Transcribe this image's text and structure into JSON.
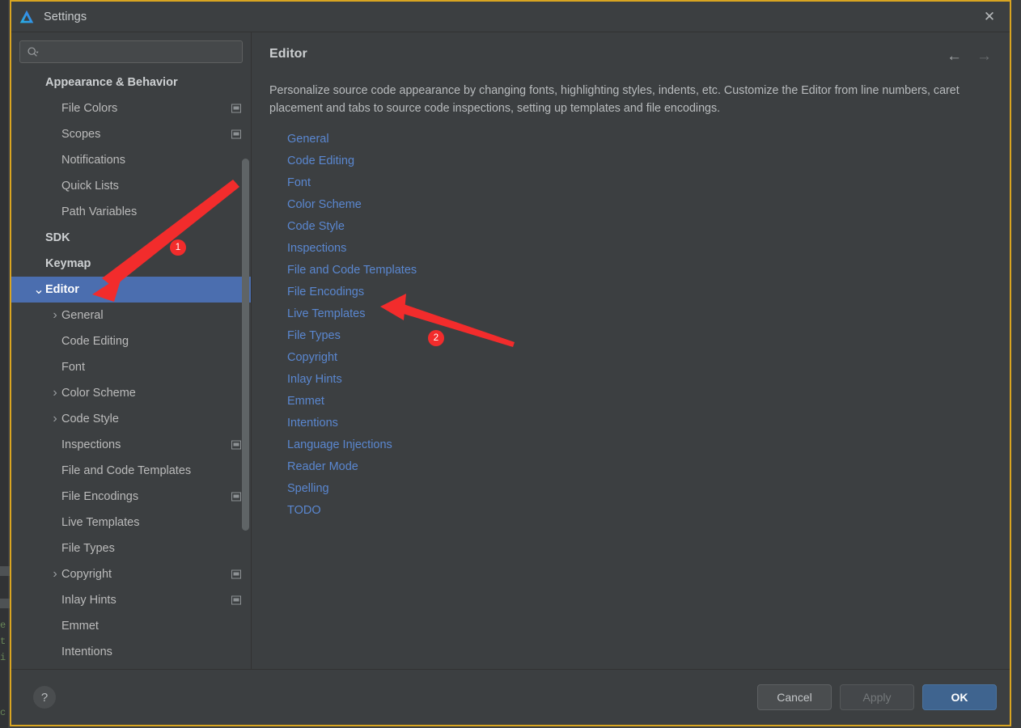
{
  "window": {
    "title": "Settings",
    "logo_icon": "android-studio-logo-icon",
    "close_icon": "✕"
  },
  "search": {
    "placeholder": "",
    "value": "",
    "icon": "search-icon"
  },
  "sidebar": {
    "items": [
      {
        "label": "Appearance & Behavior",
        "level": 0,
        "group": true,
        "twisty": "",
        "badge": false,
        "selected": false
      },
      {
        "label": "File Colors",
        "level": 1,
        "group": false,
        "twisty": "",
        "badge": true,
        "selected": false
      },
      {
        "label": "Scopes",
        "level": 1,
        "group": false,
        "twisty": "",
        "badge": true,
        "selected": false
      },
      {
        "label": "Notifications",
        "level": 1,
        "group": false,
        "twisty": "",
        "badge": false,
        "selected": false
      },
      {
        "label": "Quick Lists",
        "level": 1,
        "group": false,
        "twisty": "",
        "badge": false,
        "selected": false
      },
      {
        "label": "Path Variables",
        "level": 1,
        "group": false,
        "twisty": "",
        "badge": false,
        "selected": false
      },
      {
        "label": "SDK",
        "level": 0,
        "group": true,
        "twisty": "",
        "badge": false,
        "selected": false
      },
      {
        "label": "Keymap",
        "level": 0,
        "group": true,
        "twisty": "",
        "badge": false,
        "selected": false
      },
      {
        "label": "Editor",
        "level": 0,
        "group": true,
        "twisty": "⌄",
        "badge": false,
        "selected": true
      },
      {
        "label": "General",
        "level": 1,
        "group": false,
        "twisty": "›",
        "badge": false,
        "selected": false
      },
      {
        "label": "Code Editing",
        "level": 1,
        "group": false,
        "twisty": "",
        "badge": false,
        "selected": false
      },
      {
        "label": "Font",
        "level": 1,
        "group": false,
        "twisty": "",
        "badge": false,
        "selected": false
      },
      {
        "label": "Color Scheme",
        "level": 1,
        "group": false,
        "twisty": "›",
        "badge": false,
        "selected": false
      },
      {
        "label": "Code Style",
        "level": 1,
        "group": false,
        "twisty": "›",
        "badge": false,
        "selected": false
      },
      {
        "label": "Inspections",
        "level": 1,
        "group": false,
        "twisty": "",
        "badge": true,
        "selected": false
      },
      {
        "label": "File and Code Templates",
        "level": 1,
        "group": false,
        "twisty": "",
        "badge": false,
        "selected": false
      },
      {
        "label": "File Encodings",
        "level": 1,
        "group": false,
        "twisty": "",
        "badge": true,
        "selected": false
      },
      {
        "label": "Live Templates",
        "level": 1,
        "group": false,
        "twisty": "",
        "badge": false,
        "selected": false
      },
      {
        "label": "File Types",
        "level": 1,
        "group": false,
        "twisty": "",
        "badge": false,
        "selected": false
      },
      {
        "label": "Copyright",
        "level": 1,
        "group": false,
        "twisty": "›",
        "badge": true,
        "selected": false
      },
      {
        "label": "Inlay Hints",
        "level": 1,
        "group": false,
        "twisty": "",
        "badge": true,
        "selected": false
      },
      {
        "label": "Emmet",
        "level": 1,
        "group": false,
        "twisty": "",
        "badge": false,
        "selected": false
      },
      {
        "label": "Intentions",
        "level": 1,
        "group": false,
        "twisty": "",
        "badge": false,
        "selected": false
      }
    ]
  },
  "content": {
    "title": "Editor",
    "description": "Personalize source code appearance by changing fonts, highlighting styles, indents, etc. Customize the Editor from line numbers, caret placement and tabs to source code inspections, setting up templates and file encodings.",
    "back_icon": "←",
    "forward_icon": "→",
    "links": [
      "General",
      "Code Editing",
      "Font",
      "Color Scheme",
      "Code Style",
      "Inspections",
      "File and Code Templates",
      "File Encodings",
      "Live Templates",
      "File Types",
      "Copyright",
      "Inlay Hints",
      "Emmet",
      "Intentions",
      "Language Injections",
      "Reader Mode",
      "Spelling",
      "TODO"
    ]
  },
  "footer": {
    "help_label": "?",
    "cancel_label": "Cancel",
    "apply_label": "Apply",
    "ok_label": "OK"
  },
  "annotations": {
    "color": "#f22c2c",
    "markers": [
      {
        "label": "1"
      },
      {
        "label": "2"
      }
    ]
  },
  "colors": {
    "window_border": "#d9a521",
    "panel_bg": "#3c3f41",
    "selection": "#4b6eaf",
    "link": "#5a87d0",
    "primary_button": "#3f648f"
  },
  "backdrop": {
    "code_lines": [
      "e",
      "t",
      "i",
      "c"
    ]
  }
}
